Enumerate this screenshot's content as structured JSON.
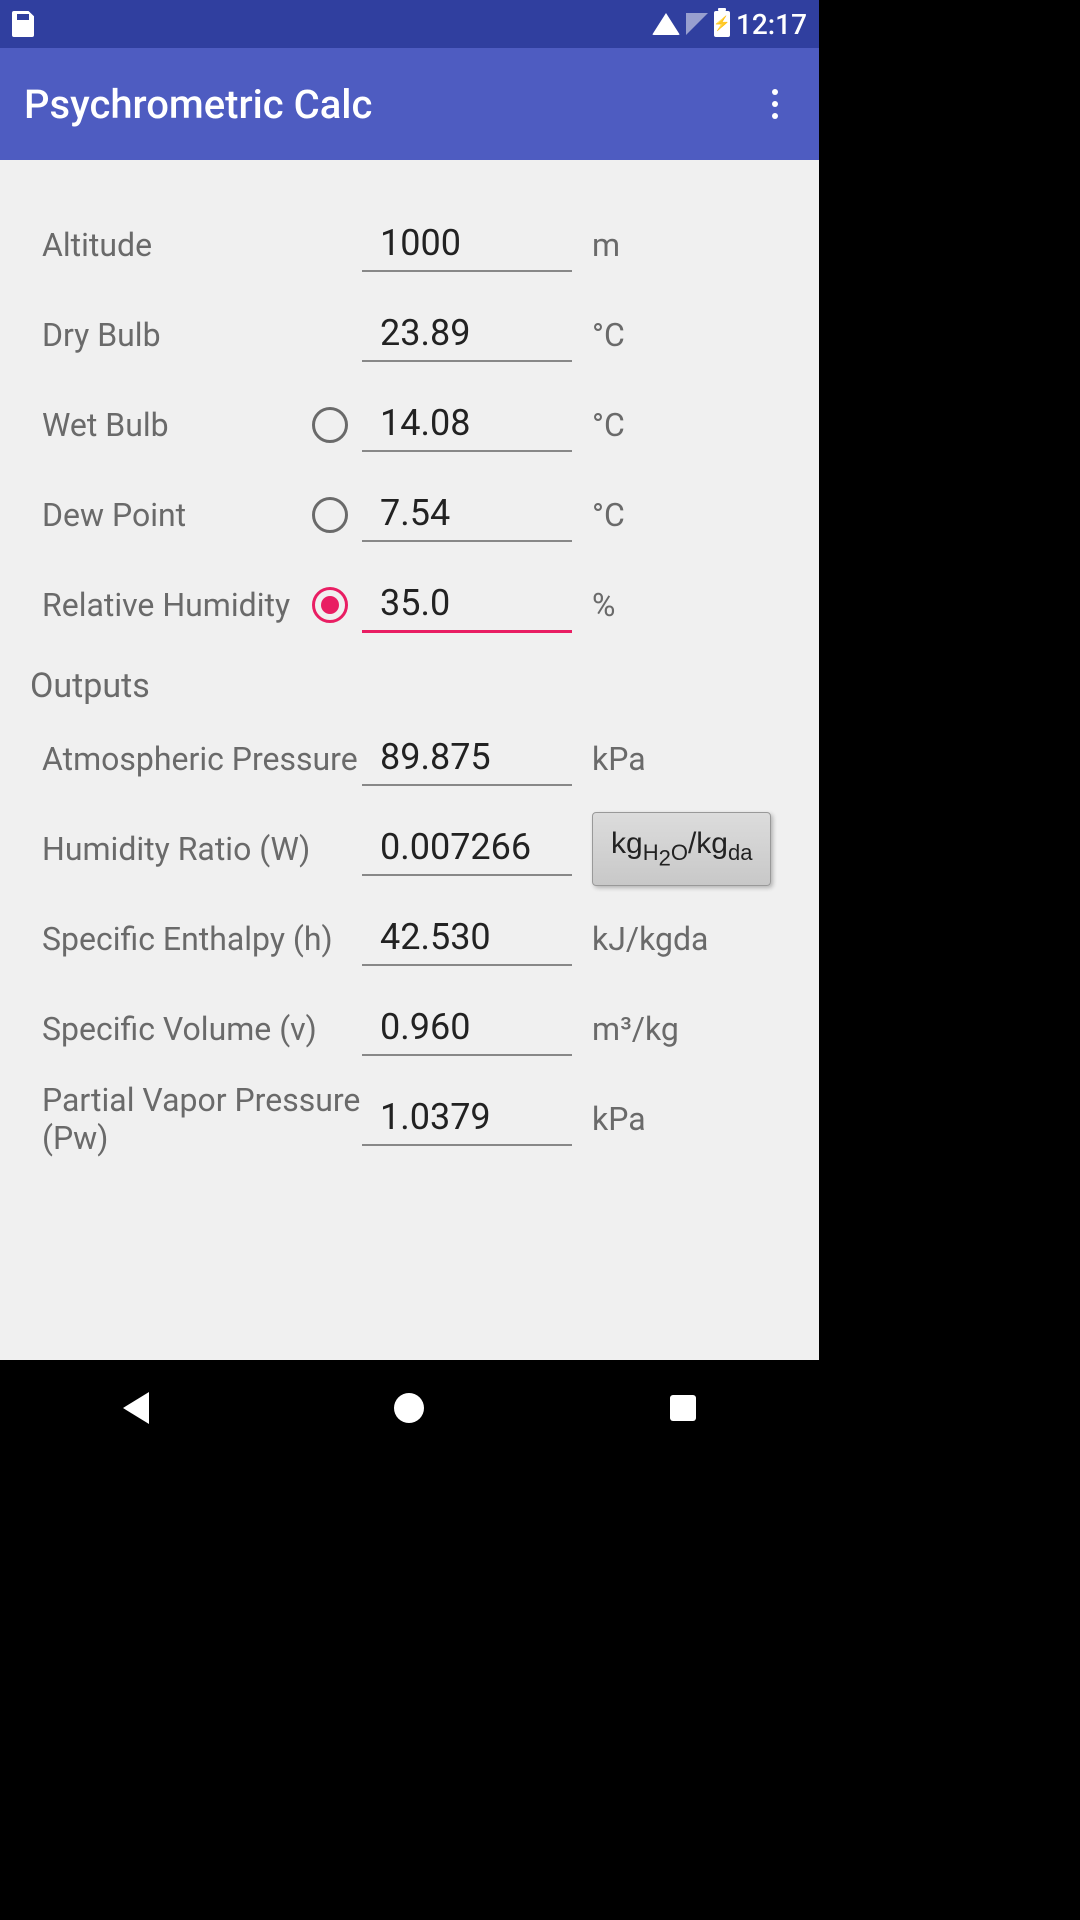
{
  "status": {
    "time": "12:17"
  },
  "app": {
    "title": "Psychrometric Calc"
  },
  "inputs": {
    "altitude": {
      "label": "Altitude",
      "value": "1000",
      "unit": "m"
    },
    "dry_bulb": {
      "label": "Dry Bulb",
      "value": "23.89",
      "unit": "°C"
    },
    "wet_bulb": {
      "label": "Wet Bulb",
      "value": "14.08",
      "unit": "°C"
    },
    "dew_point": {
      "label": "Dew Point",
      "value": "7.54",
      "unit": "°C"
    },
    "rel_humidity": {
      "label": "Relative Humidity",
      "value": "35.0",
      "unit": "%"
    }
  },
  "sections": {
    "outputs": "Outputs"
  },
  "outputs": {
    "atm_pressure": {
      "label": "Atmospheric Pressure",
      "value": "89.875",
      "unit": "kPa"
    },
    "humidity_ratio": {
      "label": "Humidity Ratio (W)",
      "value": "0.007266"
    },
    "specific_enthalpy": {
      "label": "Specific Enthalpy (h)",
      "value": "42.530",
      "unit": "kJ/kgda"
    },
    "specific_volume": {
      "label": "Specific Volume (v)",
      "value": "0.960",
      "unit": "m³/kg"
    },
    "partial_vapor": {
      "label": "Partial Vapor Pressure (Pw)",
      "value": "1.0379",
      "unit": "kPa"
    }
  }
}
